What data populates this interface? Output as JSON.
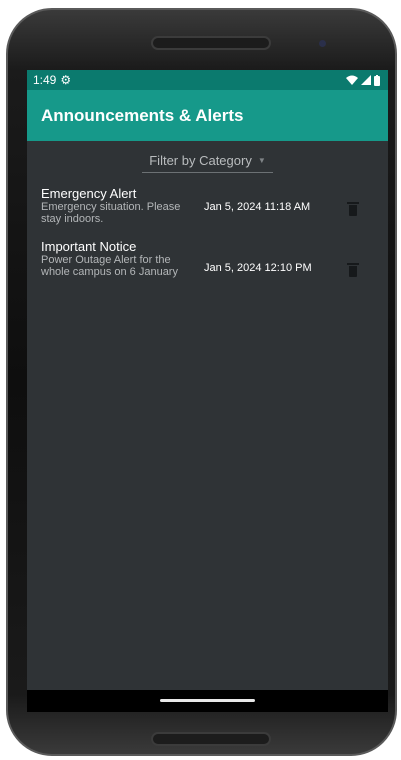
{
  "status_bar": {
    "time": "1:49",
    "settings_icon": "gear-icon",
    "wifi_icon": "wifi-icon",
    "signal_icon": "signal-icon",
    "battery_icon": "battery-icon"
  },
  "app_bar": {
    "title": "Announcements & Alerts"
  },
  "filter": {
    "label": "Filter by Category"
  },
  "announcements": [
    {
      "title": "Emergency Alert",
      "description": "Emergency situation. Please stay indoors.",
      "date": "Jan 5, 2024 11:18 AM"
    },
    {
      "title": "Important Notice",
      "description": "Power Outage Alert for the whole campus on 6 January",
      "date": "Jan 5, 2024 12:10 PM"
    }
  ],
  "fab": {
    "label": "+"
  },
  "colors": {
    "primary": "#16998a",
    "status_bar": "#0b7a6e",
    "background": "#2f3336"
  }
}
